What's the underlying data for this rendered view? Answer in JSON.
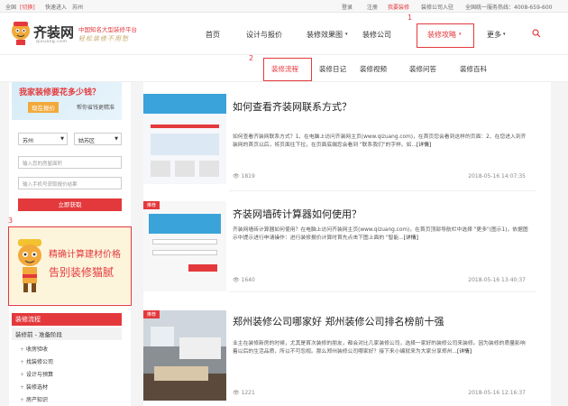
{
  "topbar": {
    "location": "全国",
    "switch": "[切换]",
    "quick_entry": "快速进入",
    "city": "苏州",
    "login": "登录",
    "register": "注册",
    "want_decor": "我要装修",
    "decor_company_entry": "装修公司入驻",
    "hotline": "全国统一服务热线：4008-659-600"
  },
  "header": {
    "brand": "齐装网",
    "brand_sub": "qizuang.com",
    "slogan1": "中国知名大型装修平台",
    "slogan2": "轻松装修不用愁",
    "nav": [
      "首页",
      "设计与报价",
      "装修效果图",
      "装修公司",
      "装修攻略",
      "更多"
    ],
    "search_icon": "search-icon"
  },
  "subnav": [
    "装修流程",
    "装修日记",
    "装修视频",
    "装修问答",
    "装修百科"
  ],
  "annotations": [
    "1",
    "2",
    "3"
  ],
  "sidebar": {
    "calc_title": "我家装修要花多少钱？",
    "calc_btn": "现在报价",
    "calc_sub": "帮你省钱更精准",
    "city_select": "苏州",
    "district_select": "姑苏区",
    "area_placeholder": "输入您的房屋面积",
    "phone_placeholder": "输入手机号获取报价结果",
    "submit": "立即获取",
    "banner_line1": "精确计算建材价格",
    "banner_line2": "告别装修猫腻",
    "category_title": "装修流程",
    "category_sub": "装修前 - 准备阶段",
    "category_items": [
      "收房验收",
      "找装修公司",
      "设计与预算",
      "装修选材",
      "房产知识"
    ]
  },
  "articles": [
    {
      "title": "如何查看齐装网联系方式？",
      "desc": "如何查看齐装网联系方式？1、在电脑上访问齐装网主页(www.qizuang.com)，在首页您会看到这样的页面：2、在您进入到齐装网的首页以后，将页面往下拉，在页面底端您会看到 \"联系我们\"的字样。如...",
      "more": "[详情]",
      "views": "1819",
      "date": "2018-05-16 14:07:35",
      "tag": ""
    },
    {
      "title": "齐装网墙砖计算器如何使用？",
      "desc": "齐装网墙砖计算器如何使用？在电脑上访问齐装网主页(www.qizuang.com)，在首页顶部导航栏中选择 \"更多\"(图示1)，依据图示中提示进行申请操作：进行装修报价计算时首先点击下图上面的 \"智能...",
      "more": "[详情]",
      "views": "1640",
      "date": "2018-05-16 13:40:37",
      "tag": "推荐"
    },
    {
      "title": "郑州装修公司哪家好 郑州装修公司排名榜前十强",
      "desc": "业主在装修新房的时候，尤其是首次装修的朋友，都会对比几家装修公司，选择一家好的装修公司来装修。因为装修的质量影响着以后的生活品质，所以不可忽视。那么郑州装修公司哪家好？接下来小编就来为大家分享郑州...",
      "more": "[详情]",
      "views": "1221",
      "date": "2018-05-16 12:16:37",
      "tag": "推荐"
    }
  ],
  "colors": {
    "accent": "#e4393c",
    "gold": "#c7a86a"
  }
}
